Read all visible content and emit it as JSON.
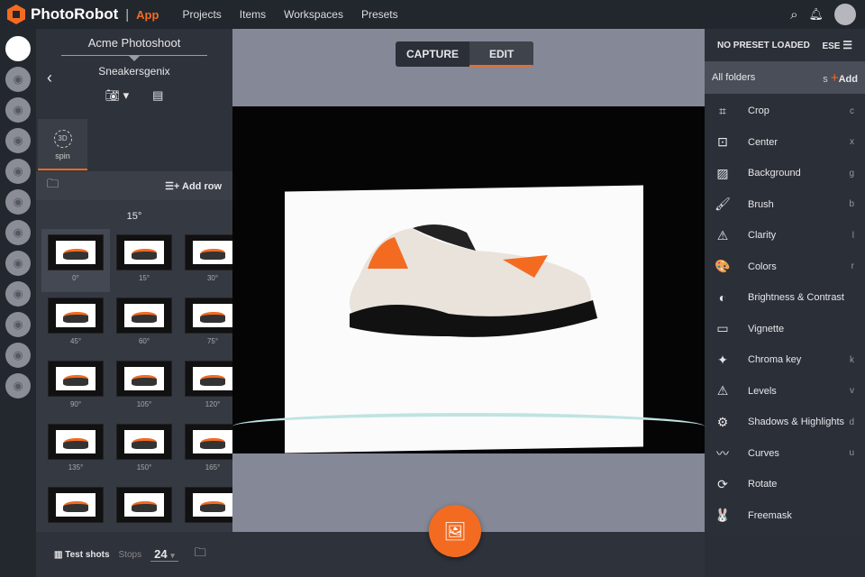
{
  "topbar": {
    "brand": "PhotoRobot",
    "separator": "|",
    "app": "App",
    "nav": [
      "Projects",
      "Items",
      "Workspaces",
      "Presets"
    ]
  },
  "panel": {
    "project": "Acme Photoshoot",
    "item": "Sneakersgenix",
    "spin_badge": "3D",
    "spin_label": "spin",
    "add_row": "Add row",
    "angle": "15°",
    "thumbs": [
      "0°",
      "15°",
      "30°",
      "45°",
      "60°",
      "75°",
      "90°",
      "105°",
      "120°",
      "135°",
      "150°",
      "165°",
      "",
      "",
      ""
    ],
    "test_shots": "Test shots",
    "stops_label": "Stops",
    "stops_value": "24"
  },
  "canvas": {
    "modes": [
      "CAPTURE",
      "EDIT"
    ],
    "active_mode": "EDIT"
  },
  "right": {
    "preset": "NO PRESET LOADED",
    "preset_trunc": "ESE",
    "folders": "All folders",
    "folders_trunc": "s",
    "add": "Add",
    "tools": [
      {
        "label": "Crop",
        "key": "c",
        "icon": "⌗"
      },
      {
        "label": "Center",
        "key": "x",
        "icon": "⊡"
      },
      {
        "label": "Background",
        "key": "g",
        "icon": "▨"
      },
      {
        "label": "Brush",
        "key": "b",
        "icon": "🖌"
      },
      {
        "label": "Clarity",
        "key": "l",
        "icon": "⚠"
      },
      {
        "label": "Colors",
        "key": "r",
        "icon": "🎨"
      },
      {
        "label": "Brightness & Contrast",
        "key": "",
        "icon": "◐"
      },
      {
        "label": "Vignette",
        "key": "",
        "icon": "▭"
      },
      {
        "label": "Chroma key",
        "key": "k",
        "icon": "✦"
      },
      {
        "label": "Levels",
        "key": "v",
        "icon": "⚠"
      },
      {
        "label": "Shadows & Highlights",
        "key": "d",
        "icon": "⚙"
      },
      {
        "label": "Curves",
        "key": "u",
        "icon": "〰"
      },
      {
        "label": "Rotate",
        "key": "",
        "icon": "⟳"
      },
      {
        "label": "Freemask",
        "key": "",
        "icon": "🐰"
      }
    ]
  },
  "colors": {
    "accent": "#f36b21"
  }
}
